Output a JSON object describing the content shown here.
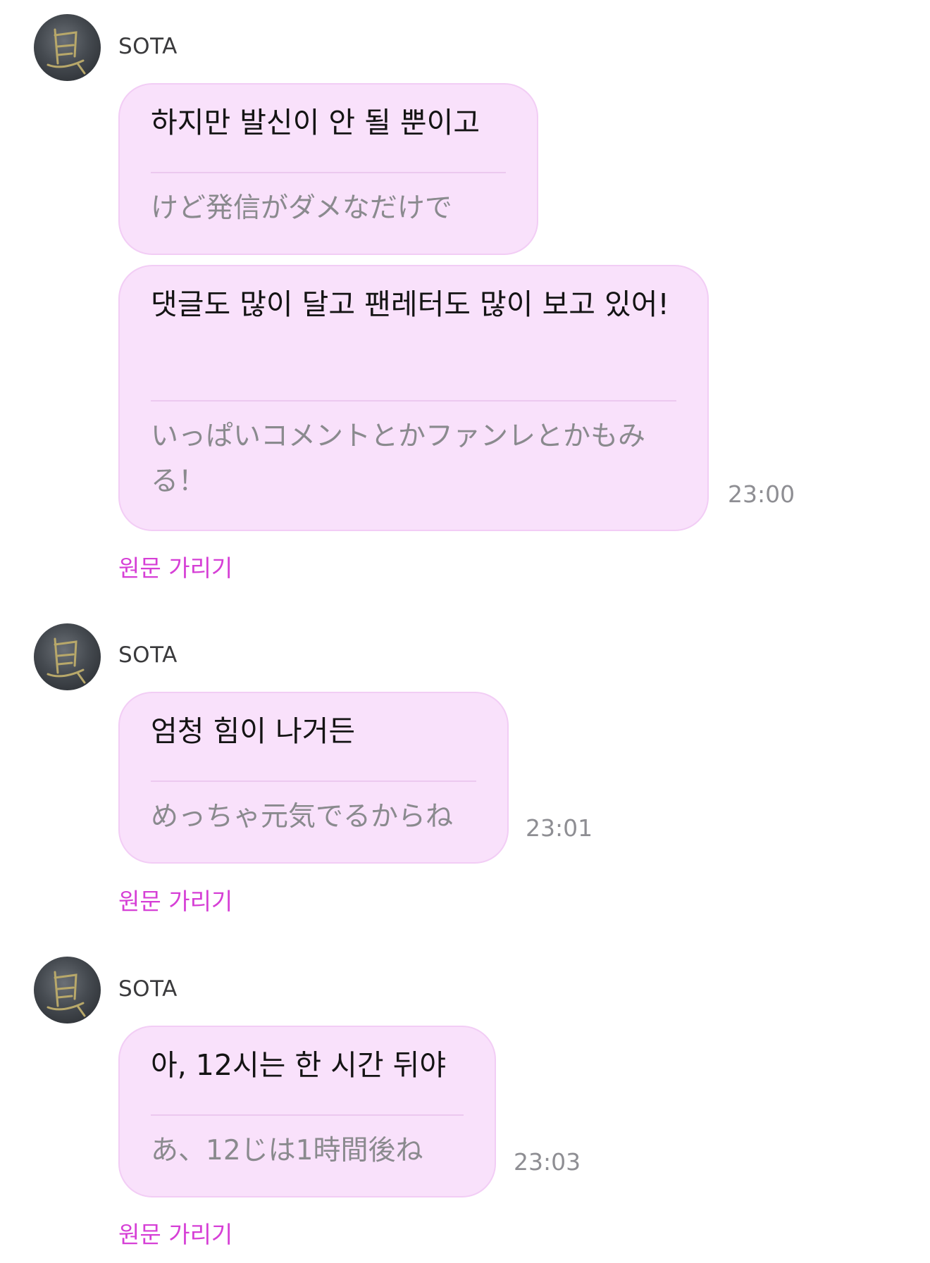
{
  "colors": {
    "bubble_bg": "#f9e1fb",
    "toggle_link": "#d63fd6",
    "timestamp": "#8e8e93"
  },
  "groups": [
    {
      "sender": "SOTA",
      "avatar_icon": "calligraphy-avatar-icon",
      "messages": [
        {
          "text": "하지만 발신이 안 될 뿐이고",
          "translation": "けど発信がダメなだけで",
          "time": ""
        },
        {
          "text": "댓글도 많이 달고 팬레터도 많이 보고 있어!",
          "translation": "いっぱいコメントとかファンレとかもみる！",
          "time": "23:00"
        }
      ],
      "toggle_label": "원문 가리기"
    },
    {
      "sender": "SOTA",
      "avatar_icon": "calligraphy-avatar-icon",
      "messages": [
        {
          "text": "엄청 힘이 나거든",
          "translation": "めっちゃ元気でるからね",
          "time": "23:01"
        }
      ],
      "toggle_label": "원문 가리기"
    },
    {
      "sender": "SOTA",
      "avatar_icon": "calligraphy-avatar-icon",
      "messages": [
        {
          "text": "아, 12시는 한 시간 뒤야",
          "translation": "あ、12じは1時間後ね",
          "time": "23:03"
        }
      ],
      "toggle_label": "원문 가리기"
    }
  ]
}
